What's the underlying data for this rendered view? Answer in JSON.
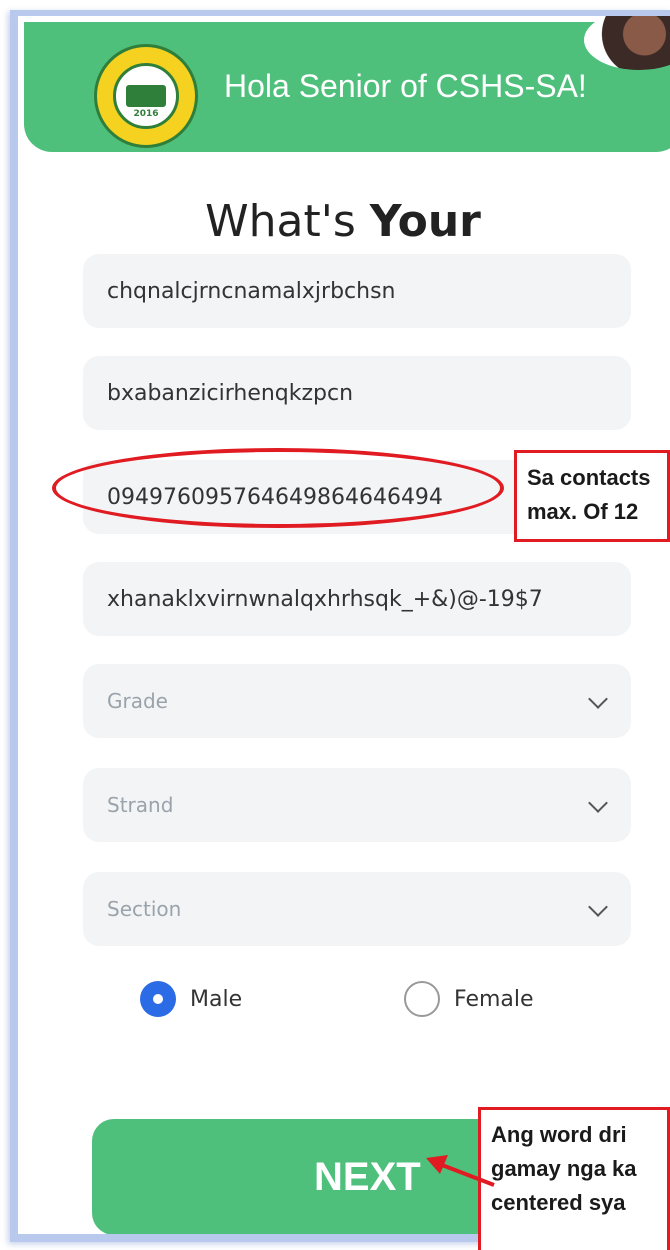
{
  "header": {
    "title": "Hola Senior of CSHS-SA!",
    "logo_year": "2016"
  },
  "heading": {
    "text_regular": "What's ",
    "text_bold": "Your"
  },
  "fields": {
    "field1": "chqnalcjrncnamalxjrbchsn",
    "field2": "bxabanzicirhenqkzpcn",
    "contact": "09497609576464986464649​4",
    "field4": "xhanaklxvirnwnalqxhrhsqk_+&)@-19$7"
  },
  "selects": {
    "grade": "Grade",
    "strand": "Strand",
    "section": "Section"
  },
  "gender": {
    "male": "Male",
    "female": "Female",
    "selected": "Male"
  },
  "next_button": "NEXT",
  "annotations": {
    "contacts_line1": "Sa contacts",
    "contacts_line2": "max. Of 12",
    "next_line1": "Ang word dri",
    "next_line2": "gamay nga ka",
    "next_line3": "centered sya"
  },
  "colors": {
    "brand_green": "#4fc07c",
    "annotation_red": "#e01b22",
    "radio_blue": "#2b6be6"
  }
}
